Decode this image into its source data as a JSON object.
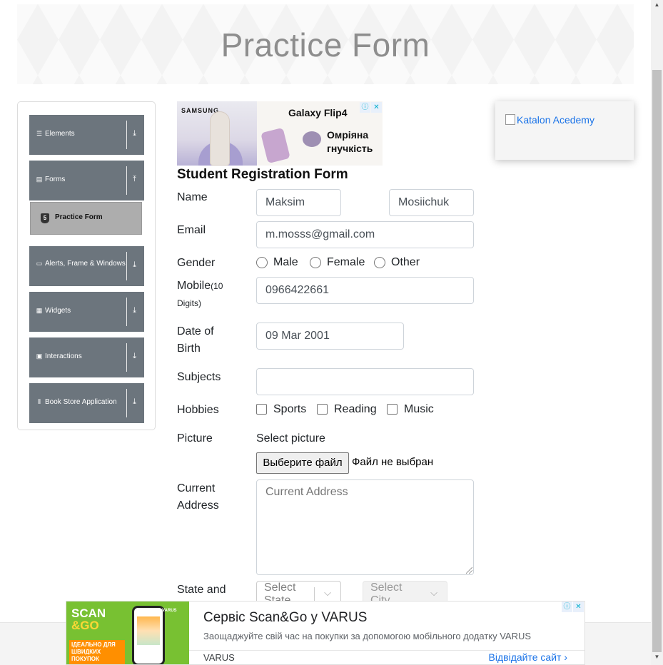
{
  "header": {
    "title": "Practice Form"
  },
  "sidebar": {
    "groups": [
      {
        "label": "Elements",
        "icon": "☰",
        "arrow": "⤓"
      },
      {
        "label": "Forms",
        "icon": "▤",
        "arrow": "⤒"
      },
      {
        "label": "Alerts, Frame & Windows",
        "icon": "▭",
        "arrow": "⤓"
      },
      {
        "label": "Widgets",
        "icon": "▦",
        "arrow": "⤓"
      },
      {
        "label": "Interactions",
        "icon": "▣",
        "arrow": "⤓"
      },
      {
        "label": "Book Store Application",
        "icon": "⫴",
        "arrow": "⤓"
      }
    ],
    "active_item": {
      "label": "Practice Form",
      "icon": "5"
    }
  },
  "ad_top": {
    "brand": "SAMSUNG",
    "product": "Galaxy Flip4",
    "tagline_1": "Омріяна",
    "tagline_2": "гнучкість",
    "info_icon": "ⓘ",
    "close_icon": "✕"
  },
  "ad_right": {
    "alt_text": "Katalon Acedemy"
  },
  "form": {
    "title": "Student Registration Form",
    "name_label": "Name",
    "first_name": "Maksim",
    "last_name": "Mosiichuk",
    "email_label": "Email",
    "email": "m.mosss@gmail.com",
    "gender_label": "Gender",
    "genders": [
      "Male",
      "Female",
      "Other"
    ],
    "mobile_label": "Mobile",
    "mobile_hint_1": "(10",
    "mobile_hint_2": "Digits)",
    "mobile": "0966422661",
    "dob_label_1": "Date of",
    "dob_label_2": "Birth",
    "dob": "09 Mar 2001",
    "subjects_label": "Subjects",
    "subjects_value": "",
    "hobbies_label": "Hobbies",
    "hobbies": [
      "Sports",
      "Reading",
      "Music"
    ],
    "picture_label": "Picture",
    "select_picture": "Select picture",
    "file_button": "Выберите файл",
    "file_status": "Файл не выбран",
    "address_label_1": "Current",
    "address_label_2": "Address",
    "address_placeholder": "Current Address",
    "state_city_label": "State and",
    "state_placeholder": "Select State",
    "city_placeholder": "Select City"
  },
  "ad_bottom": {
    "logo_line_1": "SCAN",
    "logo_line_2": "&GO",
    "logo_brand": "VARUS",
    "logo_tag": "ІДЕАЛЬНО ДЛЯ ШВИДКИХ ПОКУПОК",
    "headline": "Сервіс Scan&Go у VARUS",
    "description": "Заощаджуйте свій час на покупки за допомогою мобільного додатку VARUS",
    "advertiser": "VARUS",
    "cta": "Відвідайте сайт",
    "cta_icon": "›",
    "info_icon": "ⓘ",
    "close_icon": "✕"
  },
  "scrollbar": {
    "up_icon": "▲",
    "down_icon": "▼"
  }
}
